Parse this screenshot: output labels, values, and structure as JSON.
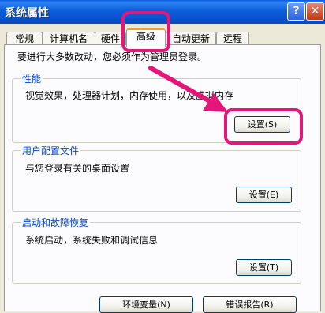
{
  "window": {
    "title": "系统属性",
    "help_glyph": "?",
    "close_glyph": "✕"
  },
  "tabs": [
    {
      "label": "常规",
      "active": false
    },
    {
      "label": "计算机名",
      "active": false
    },
    {
      "label": "硬件",
      "active": false
    },
    {
      "label": "高级",
      "active": true
    },
    {
      "label": "自动更新",
      "active": false
    },
    {
      "label": "远程",
      "active": false
    }
  ],
  "notice": "要进行大多数改动，您必须作为管理员登录。",
  "performance": {
    "title": "性能",
    "description": "视觉效果，处理器计划，内存使用，以及虚拟内存",
    "button": "设置(S)"
  },
  "user_profiles": {
    "title": "用户配置文件",
    "description": "与您登录有关的桌面设置",
    "button": "设置(E)"
  },
  "startup_recovery": {
    "title": "启动和故障恢复",
    "description": "系统启动，系统失败和调试信息",
    "button": "设置(T)"
  },
  "footer_buttons": {
    "env_vars": "环境变量(N)",
    "error_report": "错误报告(R)"
  },
  "annotation": {
    "color": "#E6157A"
  }
}
